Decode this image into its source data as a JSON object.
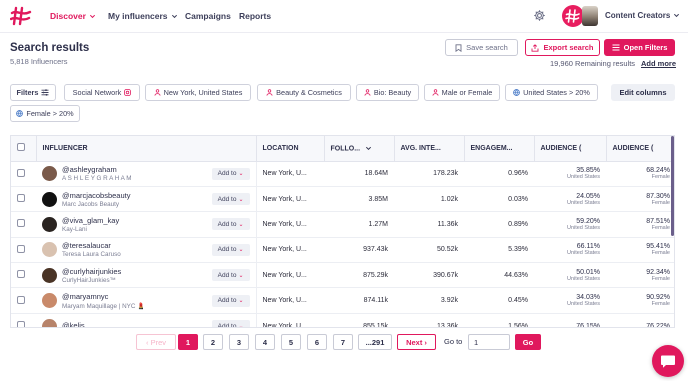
{
  "header": {
    "nav": [
      {
        "label": "Discover",
        "active": true,
        "dropdown": true
      },
      {
        "label": "My influencers",
        "active": false,
        "dropdown": true
      },
      {
        "label": "Campaigns",
        "active": false,
        "dropdown": false
      },
      {
        "label": "Reports",
        "active": false,
        "dropdown": false
      }
    ],
    "account_menu_label": "Content Creators"
  },
  "results": {
    "title": "Search results",
    "count_label": "5,818 Influencers",
    "save_label": "Save search",
    "export_label": "Export search",
    "open_filters_label": "Open Filters",
    "remaining_label": "19,960 Remaining results",
    "add_more_label": "Add more"
  },
  "filters": {
    "filters_button_label": "Filters",
    "chips": [
      {
        "label": "Social Network",
        "icon": "instagram-icon"
      },
      {
        "label": "New York, United States",
        "icon": "person-icon"
      },
      {
        "label": "Beauty & Cosmetics",
        "icon": "person-icon"
      },
      {
        "label": "Bio: Beauty",
        "icon": "person-icon"
      },
      {
        "label": "Male or Female",
        "icon": "person-icon"
      },
      {
        "label": "United States > 20%",
        "icon": "globe-icon"
      },
      {
        "label": "Female > 20%",
        "icon": "globe-icon"
      }
    ],
    "edit_columns_label": "Edit columns"
  },
  "table": {
    "columns": [
      "INFLUENCER",
      "LOCATION",
      "FOLLO...",
      "AVG. INTE...",
      "ENGAGEM...",
      "AUDIENCE (",
      "AUDIENCE ("
    ],
    "add_to_label": "Add to",
    "rows": [
      {
        "handle": "@ashleygraham",
        "name": "A S H L E Y G R A H A M",
        "location": "New York, U...",
        "followers": "18.64M",
        "avg_interactions": "178.23k",
        "engagement": "0.96%",
        "audience_country_pct": "35.85%",
        "audience_country": "United States",
        "audience_gender_pct": "68.24%",
        "audience_gender": "Female",
        "avatar_color": "#7a5a4a"
      },
      {
        "handle": "@marcjacobsbeauty",
        "name": "Marc Jacobs Beauty",
        "location": "New York, U...",
        "followers": "3.85M",
        "avg_interactions": "1.02k",
        "engagement": "0.03%",
        "audience_country_pct": "24.05%",
        "audience_country": "United States",
        "audience_gender_pct": "87.30%",
        "audience_gender": "Female",
        "avatar_color": "#111111"
      },
      {
        "handle": "@viva_glam_kay",
        "name": "Kay-Lani",
        "location": "New York, U...",
        "followers": "1.27M",
        "avg_interactions": "11.36k",
        "engagement": "0.89%",
        "audience_country_pct": "59.20%",
        "audience_country": "United States",
        "audience_gender_pct": "87.51%",
        "audience_gender": "Female",
        "avatar_color": "#2a2421"
      },
      {
        "handle": "@teresalaucar",
        "name": "Teresa Laura Caruso",
        "location": "New York, U...",
        "followers": "937.43k",
        "avg_interactions": "50.52k",
        "engagement": "5.39%",
        "audience_country_pct": "66.11%",
        "audience_country": "United States",
        "audience_gender_pct": "95.41%",
        "audience_gender": "Female",
        "avatar_color": "#d9c2b0"
      },
      {
        "handle": "@curlyhairjunkies",
        "name": "CurlyHairJunkies™",
        "location": "New York, U...",
        "followers": "875.29k",
        "avg_interactions": "390.67k",
        "engagement": "44.63%",
        "audience_country_pct": "50.01%",
        "audience_country": "United States",
        "audience_gender_pct": "92.34%",
        "audience_gender": "Female",
        "avatar_color": "#4a3426"
      },
      {
        "handle": "@maryamnyc",
        "name": "Maryam Maquillage | NYC 💄",
        "location": "New York, U...",
        "followers": "874.11k",
        "avg_interactions": "3.92k",
        "engagement": "0.45%",
        "audience_country_pct": "34.03%",
        "audience_country": "United States",
        "audience_gender_pct": "90.92%",
        "audience_gender": "Female",
        "avatar_color": "#c98a6a"
      },
      {
        "handle": "@kelis",
        "name": "",
        "location": "New York, U...",
        "followers": "855.15k",
        "avg_interactions": "13.36k",
        "engagement": "1.56%",
        "audience_country_pct": "76.15%",
        "audience_country": "",
        "audience_gender_pct": "76.22%",
        "audience_gender": "",
        "avatar_color": "#b7836a"
      }
    ]
  },
  "pagination": {
    "prev_label": "‹ Prev",
    "pages": [
      "1",
      "2",
      "3",
      "4",
      "5",
      "6",
      "7",
      "...291"
    ],
    "active_page": "1",
    "next_label": "Next ›",
    "goto_label": "Go to",
    "goto_value": "1",
    "go_button_label": "Go"
  },
  "colors": {
    "accent": "#e0185d",
    "text_dark": "#2d2f4a",
    "border": "#c9cbd6"
  }
}
